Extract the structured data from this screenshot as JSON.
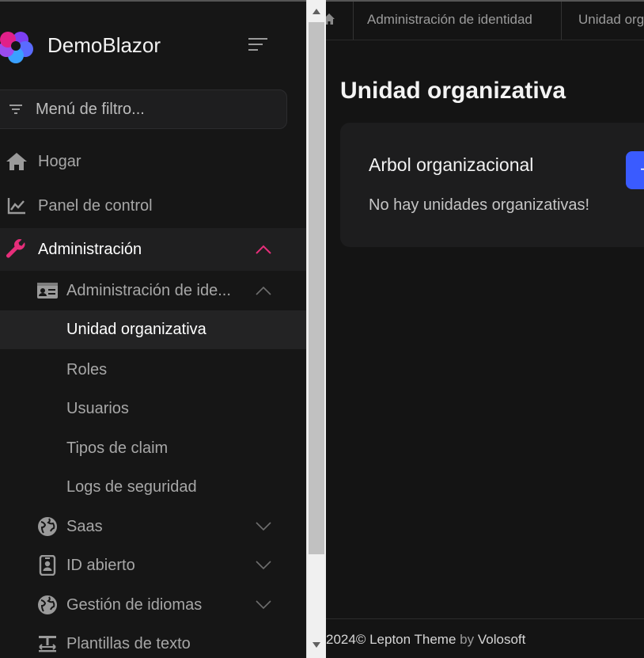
{
  "brand": {
    "name": "DemoBlazor"
  },
  "filter": {
    "placeholder": "Menú de filtro..."
  },
  "sidebar": {
    "items": [
      {
        "label": "Hogar",
        "icon": "home-icon"
      },
      {
        "label": "Panel de control",
        "icon": "chart-line-icon"
      },
      {
        "label": "Administración",
        "icon": "wrench-icon",
        "expanded": true
      },
      {
        "label": "Administración de ide...",
        "icon": "id-card-icon",
        "expanded": true
      },
      {
        "label": "Unidad organizativa",
        "active": true
      },
      {
        "label": "Roles"
      },
      {
        "label": "Usuarios"
      },
      {
        "label": "Tipos de claim"
      },
      {
        "label": "Logs de seguridad"
      },
      {
        "label": "Saas",
        "icon": "globe-icon"
      },
      {
        "label": "ID abierto",
        "icon": "id-badge-icon"
      },
      {
        "label": "Gestión de idiomas",
        "icon": "globe-icon"
      },
      {
        "label": "Plantillas de texto",
        "icon": "text-template-icon"
      }
    ]
  },
  "breadcrumb": {
    "items": [
      "Administración de identidad",
      "Unidad org"
    ]
  },
  "page": {
    "title": "Unidad organizativa"
  },
  "card": {
    "title": "Arbol organizacional",
    "empty_text": "No hay unidades organizativas!",
    "button_label": "+"
  },
  "footer": {
    "year": "2024",
    "copyright": "©",
    "theme": "Lepton Theme",
    "by": "by",
    "company": "Volosoft"
  },
  "colors": {
    "accent": "#e62e7a",
    "primary_button": "#3a5bff",
    "sidebar_bg": "#161616",
    "main_bg": "#141414"
  }
}
